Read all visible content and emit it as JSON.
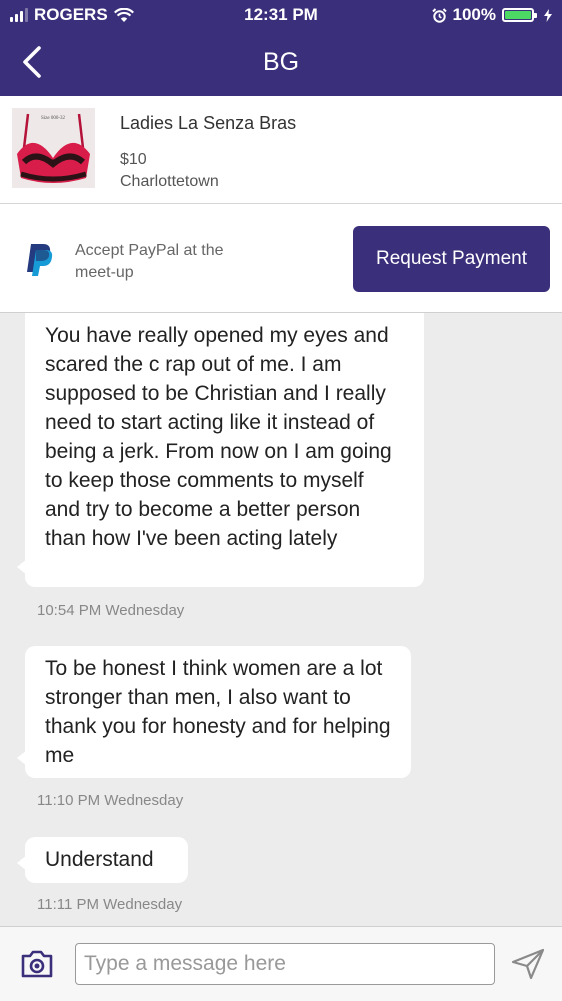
{
  "status": {
    "carrier": "ROGERS",
    "time": "12:31 PM",
    "battery": "100%",
    "battery_level": 1.0
  },
  "nav": {
    "title": "BG"
  },
  "item": {
    "tag_text": "Size 000-32",
    "title": "Ladies La Senza Bras",
    "price": "$10",
    "location": "Charlottetown"
  },
  "payment": {
    "paypal_text": "Accept PayPal at the meet-up",
    "request_button": "Request Payment"
  },
  "messages": [
    {
      "text": "You have really opened my eyes and scared the c rap out of me. I am supposed to be Christian and I really need to start acting like it instead of being a jerk. From now on I am going to keep those comments to myself and try to become a better person than how I've been acting lately",
      "timestamp": "10:54 PM Wednesday"
    },
    {
      "text": "To be honest I think women are a lot stronger than men, I also want to thank you for honesty and for helping me",
      "timestamp": "11:10 PM Wednesday"
    },
    {
      "text": "Understand",
      "timestamp": "11:11 PM Wednesday"
    }
  ],
  "composer": {
    "placeholder": "Type a message here"
  },
  "colors": {
    "brand": "#3a2f7a",
    "paypal_dark": "#253b80",
    "paypal_light": "#179bd7",
    "chat_background": "#ececec"
  },
  "icons": [
    "signal-icon",
    "wifi-icon",
    "alarm-icon",
    "battery-icon",
    "charging-icon",
    "back-chevron-icon",
    "paypal-logo-icon",
    "camera-icon",
    "send-icon"
  ]
}
